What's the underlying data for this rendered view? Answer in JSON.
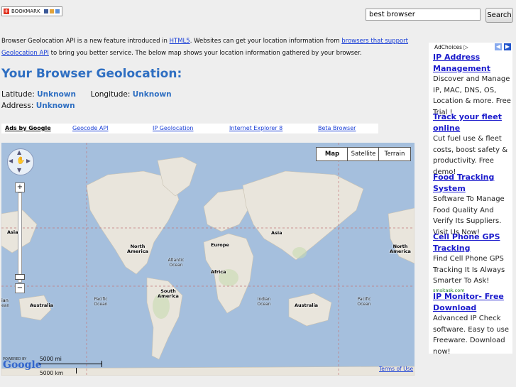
{
  "toolbar": {
    "bookmark_label": "BOOKMARK"
  },
  "search": {
    "value": "best browser",
    "button_label": "Search"
  },
  "intro": {
    "text1": "Browser Geolocation API is a new feature introduced in ",
    "link1": "HTML5",
    "text2": ". Websites can get your location information from ",
    "link2": "browsers that support Geolocation API",
    "text3": " to bring you better service. The below map shows your location information gathered by your browser."
  },
  "title": "Your Browser Geolocation:",
  "location": {
    "latitude_label": "Latitude:",
    "latitude": "Unknown",
    "longitude_label": "Longitude:",
    "longitude": "Unknown",
    "address_label": "Address:",
    "address": "Unknown"
  },
  "adlinks": {
    "ads_by": "Ads by Google",
    "links": [
      "Geocode API",
      "IP Geolocation",
      "Internet Explorer 8",
      "Beta Browser"
    ]
  },
  "map": {
    "types": [
      "Map",
      "Satellite",
      "Terrain"
    ],
    "selected_type": "Map",
    "labels": {
      "asia_left": "Asia",
      "north_america": "North America",
      "europe": "Europe",
      "asia": "Asia",
      "north_america_right": "North America",
      "africa": "Africa",
      "south_america": "South America",
      "australia_left": "Australia",
      "australia": "Australia",
      "oceania_left": "ian"
    },
    "oceans": {
      "atlantic": "Atlantic Ocean",
      "pacific_left": "Pacific Ocean",
      "indian": "Indian Ocean",
      "pacific_right": "Pacific Ocean",
      "indian_left": "ean"
    },
    "powered_by": "POWERED BY",
    "logo": "Google",
    "scale_mi": "5000 mi",
    "scale_km": "5000 km",
    "terms": "Terms of Use",
    "colors": {
      "water": "#a5bfdd",
      "land": "#e9e5dc",
      "green": "#c8dbb0"
    }
  },
  "sidebar": {
    "adchoices": "AdChoices",
    "ads": [
      {
        "title": "IP Address Management",
        "body": "Discover and Manage IP, MAC, DNS, OS, Location & more. Free Trial !"
      },
      {
        "title": "Track your fleet online",
        "body": "Cut fuel use & fleet costs, boost safety & productivity. Free demo!"
      },
      {
        "title": "Food Tracking System",
        "body": "Software To Manage Food Quality And Verify Its Suppliers. Visit Us Now!"
      },
      {
        "title": "Cell Phone GPS Tracking",
        "body": "Find Cell Phone GPS Tracking It Is Always Smarter To Ask!",
        "url": "smsitask.com"
      },
      {
        "title": "IP Monitor- Free Download",
        "body": "Advanced IP Check software. Easy to use Freeware. Download now!"
      }
    ]
  }
}
